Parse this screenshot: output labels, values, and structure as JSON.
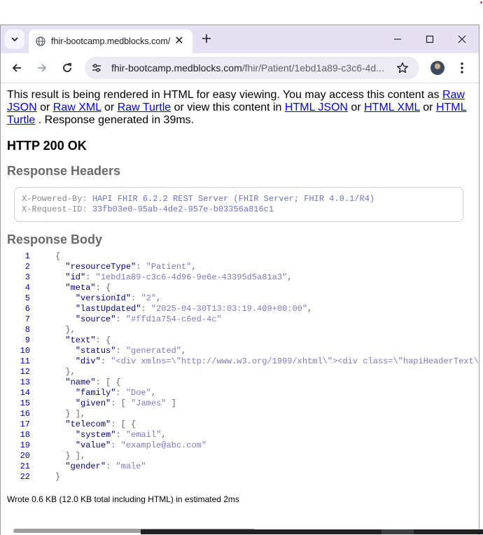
{
  "browser": {
    "tab_title": "fhir-bootcamp.medblocks.com/",
    "url_host": "fhir-bootcamp.medblocks.com",
    "url_path": "/fhir/Patient/1ebd1a89-c3c6-4d..."
  },
  "page": {
    "intro": {
      "part1": "This result is being rendered in HTML for easy viewing. You may access this content as ",
      "link_raw_json": "Raw JSON",
      "or1": " or ",
      "link_raw_xml": "Raw XML",
      "or2": " or ",
      "link_raw_turtle": "Raw Turtle",
      "part2": " or view this content in ",
      "link_html_json": "HTML JSON",
      "or3": " or ",
      "link_html_xml": "HTML XML",
      "or4": " or ",
      "link_html_turtle": "HTML Turtle",
      "part3": " . Response generated in 39ms."
    },
    "status": "HTTP 200 OK",
    "headers_title": "Response Headers",
    "headers": [
      {
        "key": "X-Powered-By:",
        "value": "HAPI FHIR 6.2.2 REST Server (FHIR Server; FHIR 4.0.1/R4)"
      },
      {
        "key": "X-Request-ID:",
        "value": "33fb03e0-95ab-4de2-957e-b03356a816c1"
      }
    ],
    "body_title": "Response Body",
    "body_lines": [
      {
        "n": "1",
        "ind": "",
        "pre": "{",
        "key": "",
        "mid": "",
        "val": "",
        "post": ""
      },
      {
        "n": "2",
        "ind": "  ",
        "pre": "",
        "key": "\"resourceType\"",
        "mid": ": ",
        "val": "\"Patient\"",
        "post": ","
      },
      {
        "n": "3",
        "ind": "  ",
        "pre": "",
        "key": "\"id\"",
        "mid": ": ",
        "val": "\"1ebd1a89-c3c6-4d96-9e6e-43395d5a81a3\"",
        "post": ","
      },
      {
        "n": "4",
        "ind": "  ",
        "pre": "",
        "key": "\"meta\"",
        "mid": ": {",
        "val": "",
        "post": ""
      },
      {
        "n": "5",
        "ind": "    ",
        "pre": "",
        "key": "\"versionId\"",
        "mid": ": ",
        "val": "\"2\"",
        "post": ","
      },
      {
        "n": "6",
        "ind": "    ",
        "pre": "",
        "key": "\"lastUpdated\"",
        "mid": ": ",
        "val": "\"2025-04-30T13:03:19.409+00:00\"",
        "post": ","
      },
      {
        "n": "7",
        "ind": "    ",
        "pre": "",
        "key": "\"source\"",
        "mid": ": ",
        "val": "\"#ffd1a754-c6ed-4c\"",
        "post": ""
      },
      {
        "n": "8",
        "ind": "  ",
        "pre": "},",
        "key": "",
        "mid": "",
        "val": "",
        "post": ""
      },
      {
        "n": "9",
        "ind": "  ",
        "pre": "",
        "key": "\"text\"",
        "mid": ": {",
        "val": "",
        "post": ""
      },
      {
        "n": "10",
        "ind": "    ",
        "pre": "",
        "key": "\"status\"",
        "mid": ": ",
        "val": "\"generated\"",
        "post": ","
      },
      {
        "n": "11",
        "ind": "    ",
        "pre": "",
        "key": "\"div\"",
        "mid": ": ",
        "val": "\"<div xmlns=\\\"http://www.w3.org/1999/xhtml\\\"><div class=\\\"hapiHeaderText\\\">James <b>DOE </b></div></div>\"",
        "post": ""
      },
      {
        "n": "12",
        "ind": "  ",
        "pre": "},",
        "key": "",
        "mid": "",
        "val": "",
        "post": ""
      },
      {
        "n": "13",
        "ind": "  ",
        "pre": "",
        "key": "\"name\"",
        "mid": ": [ {",
        "val": "",
        "post": ""
      },
      {
        "n": "14",
        "ind": "    ",
        "pre": "",
        "key": "\"family\"",
        "mid": ": ",
        "val": "\"Doe\"",
        "post": ","
      },
      {
        "n": "15",
        "ind": "    ",
        "pre": "",
        "key": "\"given\"",
        "mid": ": [ ",
        "val": "\"James\"",
        "post": " ]"
      },
      {
        "n": "16",
        "ind": "  ",
        "pre": "} ],",
        "key": "",
        "mid": "",
        "val": "",
        "post": ""
      },
      {
        "n": "17",
        "ind": "  ",
        "pre": "",
        "key": "\"telecom\"",
        "mid": ": [ {",
        "val": "",
        "post": ""
      },
      {
        "n": "18",
        "ind": "    ",
        "pre": "",
        "key": "\"system\"",
        "mid": ": ",
        "val": "\"email\"",
        "post": ","
      },
      {
        "n": "19",
        "ind": "    ",
        "pre": "",
        "key": "\"value\"",
        "mid": ": ",
        "val": "\"example@abc.com\"",
        "post": ""
      },
      {
        "n": "20",
        "ind": "  ",
        "pre": "} ],",
        "key": "",
        "mid": "",
        "val": "",
        "post": ""
      },
      {
        "n": "21",
        "ind": "  ",
        "pre": "",
        "key": "\"gender\"",
        "mid": ": ",
        "val": "\"male\"",
        "post": ""
      },
      {
        "n": "22",
        "ind": "",
        "pre": "}",
        "key": "",
        "mid": "",
        "val": "",
        "post": ""
      }
    ],
    "footer": "Wrote 0.6 KB (12.0 KB total including HTML) in estimated 2ms"
  },
  "icons": {
    "tab_menu": "chevron-down-icon",
    "favicon": "globe-icon",
    "close": "close-icon",
    "new_tab": "plus-icon",
    "minimize": "minimize-icon",
    "maximize": "maximize-icon",
    "window_close": "close-icon",
    "back": "arrow-left-icon",
    "forward": "arrow-right-icon",
    "reload": "reload-icon",
    "site_info": "tune-icon",
    "bookmark": "star-icon",
    "profile": "avatar",
    "menu": "kebab-menu-icon"
  },
  "colors": {
    "tab_strip": "#e5e1f3",
    "omnibox": "#ecebf3",
    "link": "#0000ee",
    "line_number": "#0000cc",
    "json_key": "#000080",
    "json_string": "#8079c4",
    "section_heading": "#6a6a6a"
  }
}
